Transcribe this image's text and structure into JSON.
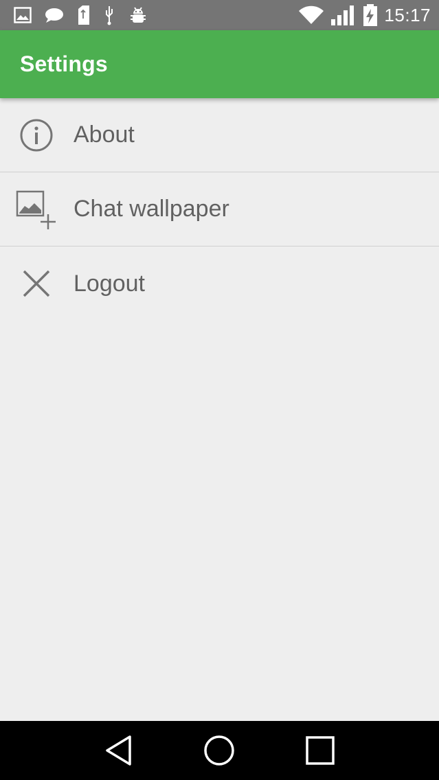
{
  "status_bar": {
    "time": "15:17",
    "left_icons": [
      "image-icon",
      "chat-bubble-icon",
      "sd-card-icon",
      "usb-icon",
      "android-debug-icon"
    ],
    "right_icons": [
      "wifi-icon",
      "signal-icon",
      "battery-charging-icon"
    ]
  },
  "app_bar": {
    "title": "Settings",
    "color": "#4caf50"
  },
  "settings": {
    "items": [
      {
        "label": "About",
        "icon": "info-icon"
      },
      {
        "label": "Chat wallpaper",
        "icon": "add-wallpaper-icon"
      },
      {
        "label": "Logout",
        "icon": "close-icon"
      }
    ]
  },
  "nav_bar": {
    "buttons": [
      "back-icon",
      "home-icon",
      "recents-icon"
    ]
  }
}
